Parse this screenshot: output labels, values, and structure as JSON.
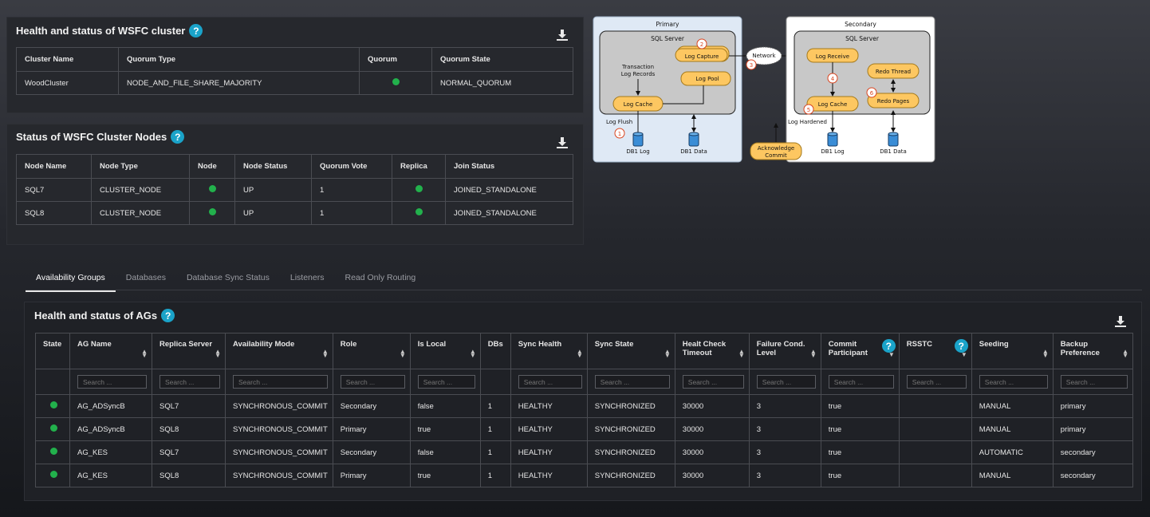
{
  "wsfc": {
    "title": "Health and status of WSFC cluster",
    "headers": [
      "Cluster Name",
      "Quorum Type",
      "Quorum",
      "Quorum State"
    ],
    "row": {
      "name": "WoodCluster",
      "type": "NODE_AND_FILE_SHARE_MAJORITY",
      "state": "NORMAL_QUORUM"
    }
  },
  "nodes": {
    "title": "Status of WSFC Cluster Nodes",
    "headers": [
      "Node Name",
      "Node Type",
      "Node",
      "Node Status",
      "Quorum Vote",
      "Replica",
      "Join Status"
    ],
    "rows": [
      {
        "name": "SQL7",
        "type": "CLUSTER_NODE",
        "status": "UP",
        "vote": "1",
        "join": "JOINED_STANDALONE"
      },
      {
        "name": "SQL8",
        "type": "CLUSTER_NODE",
        "status": "UP",
        "vote": "1",
        "join": "JOINED_STANDALONE"
      }
    ]
  },
  "diagram": {
    "primary": "Primary",
    "secondary": "Secondary",
    "sql_server": "SQL Server",
    "transaction": "Transaction",
    "log_records": "Log Records",
    "log_capture": "Log Capture",
    "log_pool": "Log Pool",
    "log_cache": "Log Cache",
    "log_flush": "Log Flush",
    "db1_log": "DB1 Log",
    "db1_data": "DB1 Data",
    "network": "Network",
    "log_receive": "Log Receive",
    "redo_thread": "Redo Thread",
    "redo_pages": "Redo Pages",
    "log_hardened": "Log Hardened",
    "acknowledge": "Acknowledge",
    "commit": "Commit",
    "steps": [
      "1",
      "2",
      "3",
      "4",
      "5",
      "6"
    ]
  },
  "tabs": [
    "Availability Groups",
    "Databases",
    "Database Sync Status",
    "Listeners",
    "Read Only Routing"
  ],
  "ag": {
    "title": "Health and status of AGs",
    "search_placeholder": "Search ...",
    "headers": {
      "state": "State",
      "ag_name": "AG Name",
      "replica_server": "Replica Server",
      "availability_mode": "Availability Mode",
      "role": "Role",
      "is_local": "Is Local",
      "dbs": "DBs",
      "sync_health": "Sync Health",
      "sync_state": "Sync State",
      "timeout_1": "Healt Check",
      "timeout_2": "Timeout",
      "failure_1": "Failure Cond.",
      "failure_2": "Level",
      "commit_1": "Commit",
      "commit_2": "Participant",
      "rsstc": "RSSTC",
      "seeding": "Seeding",
      "backup_1": "Backup",
      "backup_2": "Preference"
    },
    "rows": [
      {
        "name": "AG_ADSyncB",
        "server": "SQL7",
        "mode": "SYNCHRONOUS_COMMIT",
        "role": "Secondary",
        "local": "false",
        "dbs": "1",
        "health": "HEALTHY",
        "state": "SYNCHRONIZED",
        "timeout": "30000",
        "level": "3",
        "commit": "true",
        "rsstc": "",
        "seeding": "MANUAL",
        "backup": "primary"
      },
      {
        "name": "AG_ADSyncB",
        "server": "SQL8",
        "mode": "SYNCHRONOUS_COMMIT",
        "role": "Primary",
        "local": "true",
        "dbs": "1",
        "health": "HEALTHY",
        "state": "SYNCHRONIZED",
        "timeout": "30000",
        "level": "3",
        "commit": "true",
        "rsstc": "",
        "seeding": "MANUAL",
        "backup": "primary"
      },
      {
        "name": "AG_KES",
        "server": "SQL7",
        "mode": "SYNCHRONOUS_COMMIT",
        "role": "Secondary",
        "local": "false",
        "dbs": "1",
        "health": "HEALTHY",
        "state": "SYNCHRONIZED",
        "timeout": "30000",
        "level": "3",
        "commit": "true",
        "rsstc": "",
        "seeding": "AUTOMATIC",
        "backup": "secondary"
      },
      {
        "name": "AG_KES",
        "server": "SQL8",
        "mode": "SYNCHRONOUS_COMMIT",
        "role": "Primary",
        "local": "true",
        "dbs": "1",
        "health": "HEALTHY",
        "state": "SYNCHRONIZED",
        "timeout": "30000",
        "level": "3",
        "commit": "true",
        "rsstc": "",
        "seeding": "MANUAL",
        "backup": "secondary"
      }
    ]
  },
  "colors": {
    "status_green": "#22b14c",
    "help_blue": "#1aa3c9",
    "diagram_orange": "#fdc761"
  }
}
